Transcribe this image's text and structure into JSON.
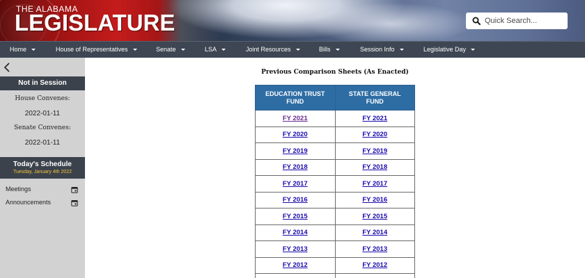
{
  "header": {
    "logo_small": "THE ALABAMA",
    "logo_big": "LEGISLATURE",
    "search_placeholder": "Quick Search..."
  },
  "nav": {
    "items": [
      {
        "label": "Home"
      },
      {
        "label": "House of Representatives"
      },
      {
        "label": "Senate"
      },
      {
        "label": "LSA"
      },
      {
        "label": "Joint Resources"
      },
      {
        "label": "Bills"
      },
      {
        "label": "Session Info"
      },
      {
        "label": "Legislative Day"
      }
    ]
  },
  "sidebar": {
    "session_status": "Not in Session",
    "house_label": "House Convenes:",
    "house_date": "2022-01-11",
    "senate_label": "Senate Convenes:",
    "senate_date": "2022-01-11",
    "schedule_title": "Today's Schedule",
    "schedule_date": "Tuesday, January 4th 2022",
    "links": [
      {
        "label": "Meetings",
        "icon": "calendar-icon"
      },
      {
        "label": "Announcements",
        "icon": "calendar-icon"
      }
    ]
  },
  "main": {
    "title": "Previous Comparison Sheets (As Enacted)",
    "columns": [
      "EDUCATION TRUST FUND",
      "STATE GENERAL FUND"
    ],
    "rows": [
      [
        "FY 2021",
        "FY 2021"
      ],
      [
        "FY 2020",
        "FY 2020"
      ],
      [
        "FY 2019",
        "FY 2019"
      ],
      [
        "FY 2018",
        "FY 2018"
      ],
      [
        "FY 2017",
        "FY 2017"
      ],
      [
        "FY 2016",
        "FY 2016"
      ],
      [
        "FY 2015",
        "FY 2015"
      ],
      [
        "FY 2014",
        "FY 2014"
      ],
      [
        "FY 2013",
        "FY 2013"
      ],
      [
        "FY 2012",
        "FY 2012"
      ],
      [
        "",
        ""
      ]
    ]
  },
  "colors": {
    "nav_bg": "#3d4652",
    "sidebar_bg": "#d2d2d2",
    "sidebar_header_bg": "#3c424c",
    "table_header_bg": "#2e6da4",
    "link": "#1a0dab",
    "visited_link": "#6b2c8f",
    "schedule_date": "#f2c53d"
  }
}
